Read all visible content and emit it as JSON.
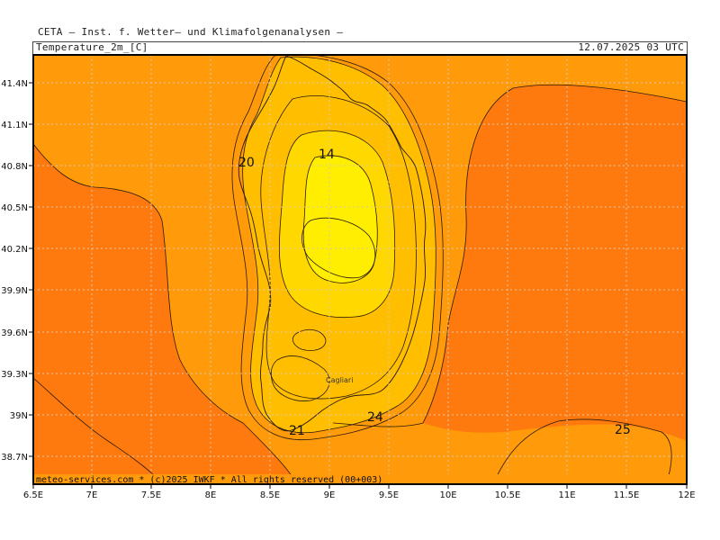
{
  "header": {
    "title": "CETA — Inst. f. Wetter— und Klimafolgenanalysen —",
    "variable": "Temperature_2m_[C]",
    "valid_time": "12.07.2025 03 UTC"
  },
  "map": {
    "lon_labels": [
      "6.5E",
      "7E",
      "7.5E",
      "8E",
      "8.5E",
      "9E",
      "9.5E",
      "10E",
      "10.5E",
      "11E",
      "11.5E",
      "12E"
    ],
    "lat_labels": [
      "41.4N",
      "41.1N",
      "40.8N",
      "40.5N",
      "40.2N",
      "39.9N",
      "39.6N",
      "39.3N",
      "39N",
      "38.7N"
    ],
    "contour_labels": [
      "14",
      "20",
      "21",
      "24",
      "25"
    ],
    "city": "Cagliari",
    "colors": {
      "sea_warm": "#ff7a0e",
      "sea": "#ff9a0a",
      "land_mid": "#ffbf00",
      "land_cool": "#ffd800",
      "land_coolest": "#ffee00"
    }
  },
  "footer": {
    "credit": "meteo-services.com * (c)2025 IWKF * All rights reserved (00+003)"
  }
}
